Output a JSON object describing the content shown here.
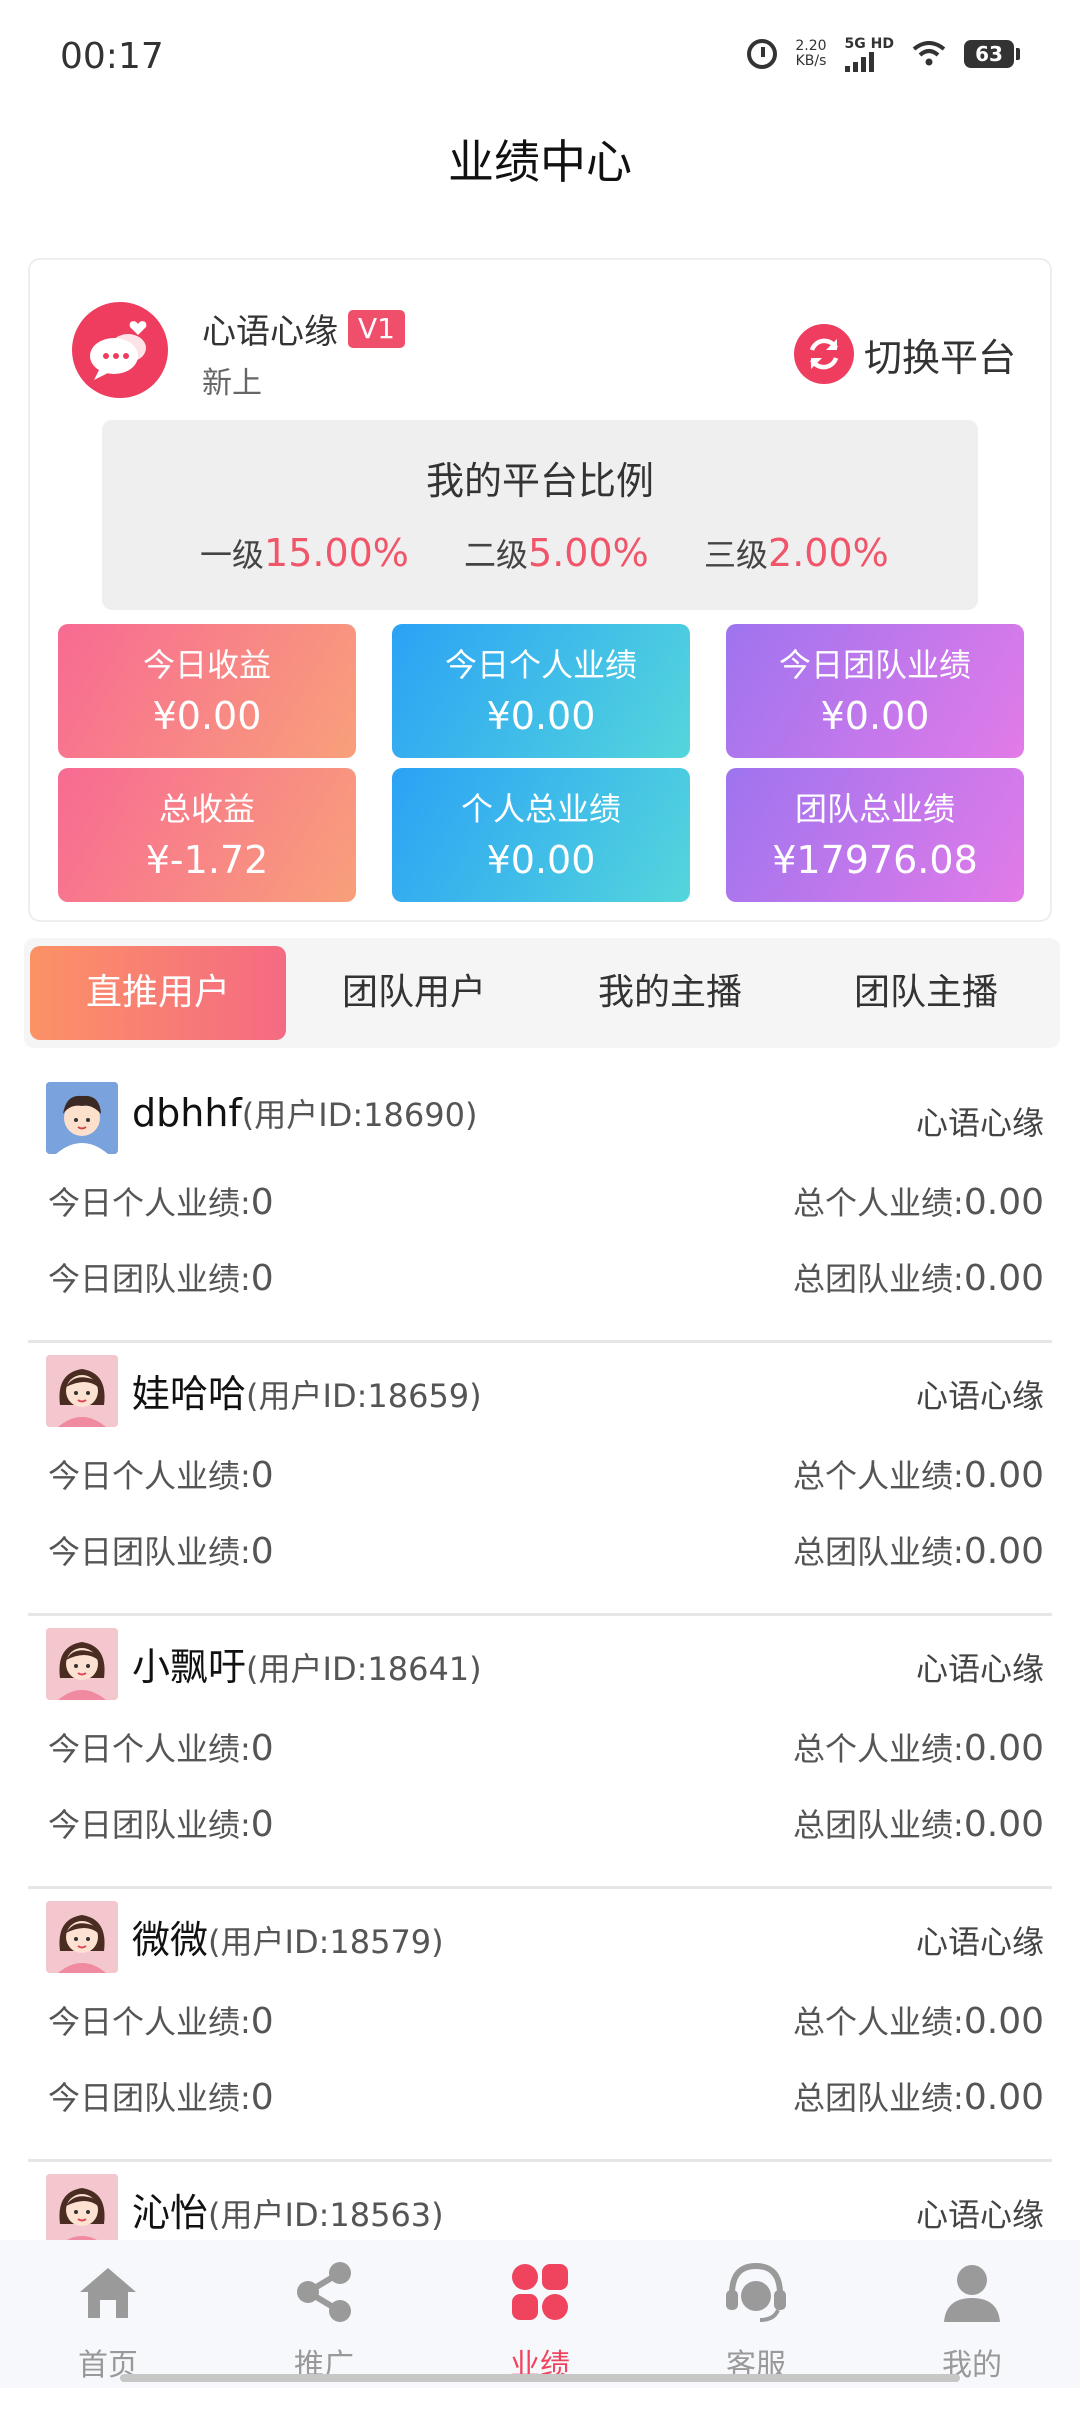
{
  "status_bar": {
    "time": "00:17",
    "speed_value": "2.20",
    "speed_unit": "KB/s",
    "network": "5G HD",
    "battery": "63"
  },
  "header": {
    "title": "业绩中心"
  },
  "platform": {
    "name": "心语心缘",
    "level": "V1",
    "subtitle": "新上",
    "switch_label": "切换平台",
    "ratio_title": "我的平台比例",
    "ratios": [
      {
        "label": "一级",
        "value": "15.00%"
      },
      {
        "label": "二级",
        "value": "5.00%"
      },
      {
        "label": "三级",
        "value": "2.00%"
      }
    ]
  },
  "stats": [
    {
      "label": "今日收益",
      "value": "¥0.00"
    },
    {
      "label": "今日个人业绩",
      "value": "¥0.00"
    },
    {
      "label": "今日团队业绩",
      "value": "¥0.00"
    },
    {
      "label": "总收益",
      "value": "¥-1.72"
    },
    {
      "label": "个人总业绩",
      "value": "¥0.00"
    },
    {
      "label": "团队总业绩",
      "value": "¥17976.08"
    }
  ],
  "tabs": [
    {
      "label": "直推用户",
      "active": true
    },
    {
      "label": "团队用户",
      "active": false
    },
    {
      "label": "我的主播",
      "active": false
    },
    {
      "label": "团队主播",
      "active": false
    }
  ],
  "users": [
    {
      "name": "dbhhf",
      "uid": "(用户ID:18690)",
      "platform": "心语心缘",
      "avatar": "boy-avatar",
      "today_personal_label": "今日个人业绩:",
      "today_personal": "0",
      "total_personal_label": "总个人业绩:",
      "total_personal": "0.00",
      "today_team_label": "今日团队业绩:",
      "today_team": "0",
      "total_team_label": "总团队业绩:",
      "total_team": "0.00"
    },
    {
      "name": "娃哈哈",
      "uid": "(用户ID:18659)",
      "platform": "心语心缘",
      "avatar": "girl-avatar",
      "today_personal_label": "今日个人业绩:",
      "today_personal": "0",
      "total_personal_label": "总个人业绩:",
      "total_personal": "0.00",
      "today_team_label": "今日团队业绩:",
      "today_team": "0",
      "total_team_label": "总团队业绩:",
      "total_team": "0.00"
    },
    {
      "name": "小飘吁",
      "uid": "(用户ID:18641)",
      "platform": "心语心缘",
      "avatar": "girl-avatar",
      "today_personal_label": "今日个人业绩:",
      "today_personal": "0",
      "total_personal_label": "总个人业绩:",
      "total_personal": "0.00",
      "today_team_label": "今日团队业绩:",
      "today_team": "0",
      "total_team_label": "总团队业绩:",
      "total_team": "0.00"
    },
    {
      "name": "微微",
      "uid": "(用户ID:18579)",
      "platform": "心语心缘",
      "avatar": "girl-avatar",
      "today_personal_label": "今日个人业绩:",
      "today_personal": "0",
      "total_personal_label": "总个人业绩:",
      "total_personal": "0.00",
      "today_team_label": "今日团队业绩:",
      "today_team": "0",
      "total_team_label": "总团队业绩:",
      "total_team": "0.00"
    },
    {
      "name": "沁怡",
      "uid": "(用户ID:18563)",
      "platform": "心语心缘",
      "avatar": "girl-avatar"
    }
  ],
  "nav": [
    {
      "label": "首页",
      "icon": "home-icon",
      "active": false
    },
    {
      "label": "推广",
      "icon": "share-icon",
      "active": false
    },
    {
      "label": "业绩",
      "icon": "performance-icon",
      "active": true
    },
    {
      "label": "客服",
      "icon": "customer-service-icon",
      "active": false
    },
    {
      "label": "我的",
      "icon": "profile-icon",
      "active": false
    }
  ],
  "colors": {
    "accent": "#f0445e",
    "ratio_value": "#f0556a",
    "nav_inactive": "#999999"
  }
}
